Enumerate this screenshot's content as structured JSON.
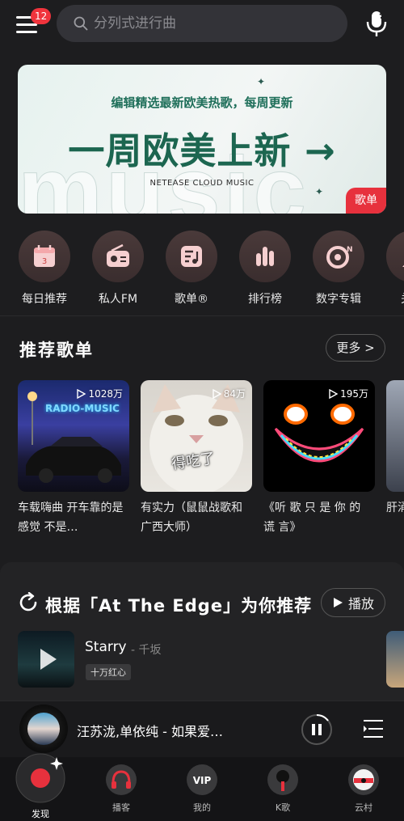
{
  "header": {
    "badge": "12",
    "search_placeholder": "分列式进行曲"
  },
  "banner": {
    "subtitle": "编辑精选最新欧美热歌，每周更新",
    "title": "一周欧美上新 →",
    "brand": "NETEASE CLOUD MUSIC",
    "watermark": "music",
    "tag": "歌单"
  },
  "quick": [
    {
      "label": "每日推荐",
      "icon": "calendar-icon"
    },
    {
      "label": "私人FM",
      "icon": "radio-icon"
    },
    {
      "label": "歌单®",
      "icon": "playlist-icon"
    },
    {
      "label": "排行榜",
      "icon": "chart-icon"
    },
    {
      "label": "数字专辑",
      "icon": "album-icon"
    },
    {
      "label": "关注",
      "icon": "follow-icon"
    }
  ],
  "playlists_section": {
    "title": "推荐歌单",
    "more": "更多 >",
    "items": [
      {
        "count": "1028万",
        "name": "车载嗨曲 开车靠的是感觉 不是…",
        "cover_text": "RADIO-MUSIC"
      },
      {
        "count": "84万",
        "name": "有实力（鼠鼠战歌和广西大师）",
        "cover_text": "得吃了"
      },
      {
        "count": "195万",
        "name": "《听 歌 只 是 你 的 谎 言》",
        "cover_text": ""
      },
      {
        "count": "",
        "name": "肝涌作业",
        "cover_text": ""
      }
    ]
  },
  "personal_section": {
    "title": "根据「At The Edge」为你推荐",
    "play_all": "播放",
    "song": {
      "title": "Starry",
      "artist": "- 千坂",
      "tag": "十万红心"
    }
  },
  "mini_player": {
    "title": "汪苏泷,单依纯 - 如果爱…"
  },
  "nav": [
    {
      "label": "发现",
      "icon": "record-icon"
    },
    {
      "label": "播客",
      "icon": "podcast-icon"
    },
    {
      "label": "我的",
      "icon": "vip-icon"
    },
    {
      "label": "K歌",
      "icon": "mic-icon"
    },
    {
      "label": "云村",
      "icon": "vinyl-icon"
    }
  ],
  "colors": {
    "accent": "#e7313d",
    "background": "#1d1d1f",
    "banner_green": "#1c6650"
  }
}
